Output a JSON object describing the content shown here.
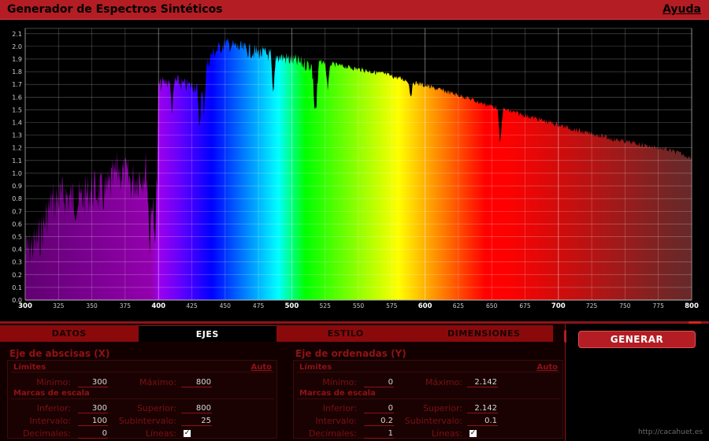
{
  "header": {
    "title": "Generador de Espectros Sintéticos",
    "help": "Ayuda"
  },
  "tabs": [
    {
      "label": "DATOS",
      "active": false
    },
    {
      "label": "EJES",
      "active": true
    },
    {
      "label": "ESTILO",
      "active": false
    },
    {
      "label": "DIMENSIONES",
      "active": false
    }
  ],
  "x_axis": {
    "title": "Eje de abscisas (X)",
    "limits_label": "Límites",
    "auto_label": "Auto",
    "min_label": "Mínimo:",
    "min_value": "300",
    "max_label": "Máximo:",
    "max_value": "800",
    "marks_label": "Marcas de escala",
    "lower_label": "Inferior:",
    "lower_value": "300",
    "upper_label": "Superior:",
    "upper_value": "800",
    "interval_label": "Intervalo:",
    "interval_value": "100",
    "subinterval_label": "Subintervalo:",
    "subinterval_value": "25",
    "decimals_label": "Decimales:",
    "decimals_value": "0",
    "lines_label": "Líneas:",
    "lines_checked": true
  },
  "y_axis": {
    "title": "Eje de ordenadas (Y)",
    "limits_label": "Límites",
    "auto_label": "Auto",
    "min_label": "Mínimo:",
    "min_value": "0",
    "max_label": "Máximo:",
    "max_value": "2.142",
    "marks_label": "Marcas de escala",
    "lower_label": "Inferior:",
    "lower_value": "0",
    "upper_label": "Superior:",
    "upper_value": "2.142",
    "interval_label": "Intervalo:",
    "interval_value": "0.2",
    "subinterval_label": "Subintervalo:",
    "subinterval_value": "0.1",
    "decimals_label": "Decimales:",
    "decimals_value": "1",
    "lines_label": "Líneas:",
    "lines_checked": true
  },
  "generate_label": "GENERAR",
  "footer_url": "http://cacahuet.es",
  "colors": {
    "brand_red": "#b31d23",
    "dark_red": "#8a0a0c",
    "background": "#000000"
  },
  "chart_data": {
    "type": "area",
    "xlim": [
      300,
      800
    ],
    "ylim": [
      0,
      2.142
    ],
    "x_major_ticks": [
      300,
      400,
      500,
      600,
      700,
      800
    ],
    "x_minor_ticks": [
      325,
      350,
      375,
      425,
      450,
      475,
      525,
      550,
      575,
      625,
      650,
      675,
      725,
      750,
      775
    ],
    "y_ticks": [
      0,
      0.1,
      0.2,
      0.3,
      0.4,
      0.5,
      0.6,
      0.7,
      0.8,
      0.9,
      1.0,
      1.1,
      1.2,
      1.3,
      1.4,
      1.5,
      1.6,
      1.7,
      1.8,
      1.9,
      2.0,
      2.1
    ],
    "grid": true,
    "envelope": {
      "x": [
        300,
        310,
        320,
        330,
        340,
        350,
        360,
        370,
        380,
        390,
        399,
        400,
        410,
        420,
        430,
        440,
        450,
        460,
        470,
        480,
        490,
        500,
        510,
        520,
        530,
        540,
        550,
        560,
        570,
        580,
        590,
        600,
        610,
        620,
        630,
        640,
        650,
        660,
        670,
        680,
        690,
        700,
        710,
        720,
        730,
        740,
        750,
        760,
        770,
        780,
        790,
        800
      ],
      "y": [
        0.55,
        0.65,
        0.95,
        1.0,
        0.95,
        1.05,
        1.0,
        1.2,
        1.1,
        1.2,
        1.1,
        1.75,
        1.8,
        1.75,
        1.75,
        2.0,
        2.08,
        2.05,
        2.02,
        2.0,
        1.98,
        1.95,
        1.92,
        1.9,
        1.88,
        1.86,
        1.84,
        1.82,
        1.8,
        1.77,
        1.74,
        1.71,
        1.68,
        1.65,
        1.62,
        1.58,
        1.55,
        1.52,
        1.49,
        1.46,
        1.43,
        1.4,
        1.37,
        1.34,
        1.32,
        1.29,
        1.27,
        1.25,
        1.23,
        1.21,
        1.18,
        1.14
      ]
    },
    "absorption_lines": [
      {
        "x": 393.4,
        "depth": 0.55
      },
      {
        "x": 396.8,
        "depth": 0.5
      },
      {
        "x": 410.2,
        "depth": 0.25
      },
      {
        "x": 430.8,
        "depth": 0.35
      },
      {
        "x": 434.0,
        "depth": 0.3
      },
      {
        "x": 486.1,
        "depth": 0.35
      },
      {
        "x": 516.9,
        "depth": 0.25
      },
      {
        "x": 518.4,
        "depth": 0.28
      },
      {
        "x": 527.0,
        "depth": 0.2
      },
      {
        "x": 589.3,
        "depth": 0.12
      },
      {
        "x": 656.3,
        "depth": 0.3
      }
    ]
  }
}
